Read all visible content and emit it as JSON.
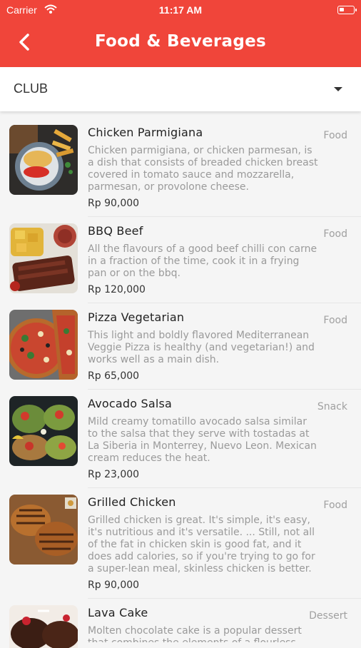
{
  "status_bar": {
    "carrier": "Carrier",
    "time": "11:17 AM"
  },
  "header": {
    "title": "Food & Beverages",
    "back_icon": "chevron-left-icon"
  },
  "outlet_select": {
    "value": "CLUB"
  },
  "colors": {
    "accent": "#f0453a"
  },
  "items": [
    {
      "name": "Chicken Parmigiana",
      "category": "Food",
      "description": "Chicken parmigiana, or chicken parmesan, is a dish that consists of breaded chicken breast covered in tomato sauce and mozzarella, parmesan, or provolone cheese.",
      "price": "Rp 90,000"
    },
    {
      "name": "BBQ Beef",
      "category": "Food",
      "description": "All the flavours of a good beef chilli con carne in a fraction of the time, cook it in a frying pan or on the bbq.",
      "price": "Rp 120,000"
    },
    {
      "name": "Pizza Vegetarian",
      "category": "Food",
      "description": "This light and boldly flavored Mediterranean Veggie Pizza is healthy (and vegetarian!) and works well as a main dish.",
      "price": "Rp 65,000"
    },
    {
      "name": "Avocado Salsa",
      "category": "Snack",
      "description": "Mild creamy tomatillo avocado salsa similar to the salsa that they serve with tostadas at La Siberia in Monterrey, Nuevo Leon. Mexican cream reduces the heat.",
      "price": "Rp 23,000"
    },
    {
      "name": "Grilled Chicken",
      "category": "Food",
      "description": "Grilled chicken is great. It's simple, it's easy, it's nutritious and it's versatile. ... Still, not all of the fat in chicken skin is good fat, and it does add calories, so if you're trying to go for a super-lean meal, skinless chicken is better.",
      "price": "Rp 90,000"
    },
    {
      "name": "Lava Cake",
      "category": "Dessert",
      "description": "Molten chocolate cake is a popular dessert that combines the elements of a flourless",
      "price": ""
    }
  ]
}
